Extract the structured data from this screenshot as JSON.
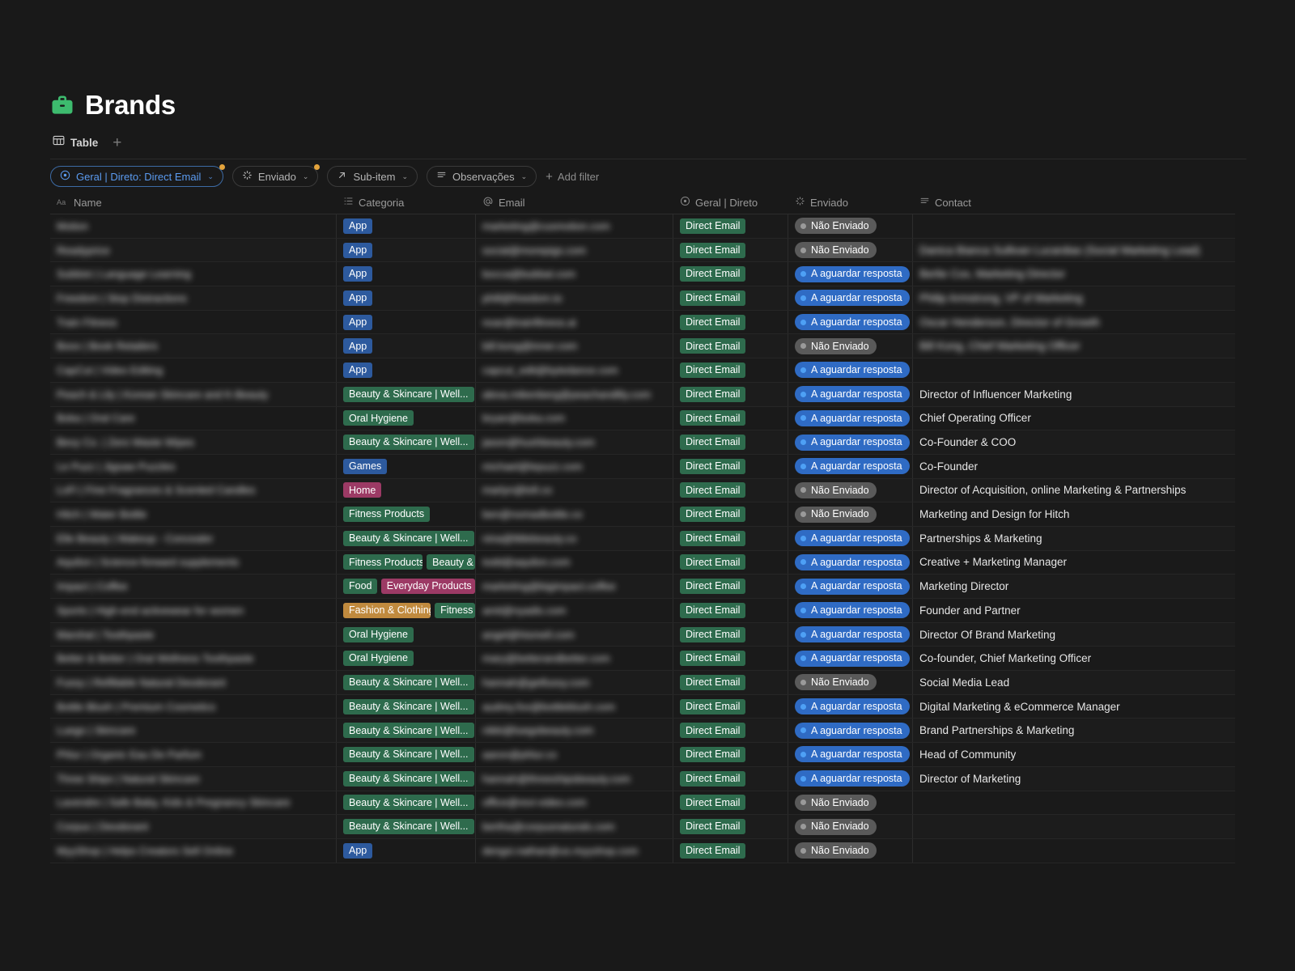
{
  "header": {
    "title": "Brands",
    "icon": "briefcase-icon",
    "icon_color": "#3dbb6e",
    "tabs": [
      {
        "label": "Table",
        "icon": "table-icon"
      }
    ],
    "add_tab_label": "+"
  },
  "filters": {
    "chips": [
      {
        "label": "Geral | Direto: Direct Email",
        "icon": "target-icon",
        "active": true,
        "has_badge": true,
        "caret": "⌄"
      },
      {
        "label": "Enviado",
        "icon": "loading-icon",
        "active": false,
        "has_badge": true,
        "caret": "⌄"
      },
      {
        "label": "Sub-item",
        "icon": "arrow-up-right-icon",
        "active": false,
        "has_badge": false,
        "caret": "⌄"
      },
      {
        "label": "Observações",
        "icon": "list-icon",
        "active": false,
        "has_badge": false,
        "caret": "⌄"
      }
    ],
    "add_filter_label": "Add filter"
  },
  "table": {
    "columns": [
      {
        "key": "name",
        "label": "Name",
        "icon": "text-aa-icon"
      },
      {
        "key": "categoria",
        "label": "Categoria",
        "icon": "multiselect-icon"
      },
      {
        "key": "email",
        "label": "Email",
        "icon": "at-icon"
      },
      {
        "key": "geral",
        "label": "Geral | Direto",
        "icon": "target-icon"
      },
      {
        "key": "enviado",
        "label": "Enviado",
        "icon": "loading-icon"
      },
      {
        "key": "contact",
        "label": "Contact",
        "icon": "list-icon"
      }
    ],
    "rows": [
      {
        "name": "Motion",
        "name_redacted": true,
        "categoria": [
          {
            "text": "App",
            "color": "blue"
          }
        ],
        "email": "marketing@cusmotion.com",
        "email_redacted": true,
        "geral": "Direct Email",
        "enviado": "Não Enviado",
        "enviado_state": "gray",
        "contact": "",
        "contact_redacted": false
      },
      {
        "name": "Readyprice",
        "name_redacted": true,
        "categoria": [
          {
            "text": "App",
            "color": "blue"
          }
        ],
        "email": "social@morepigs.com",
        "email_redacted": true,
        "geral": "Direct Email",
        "enviado": "Não Enviado",
        "enviado_state": "gray",
        "contact": "Danica Bianca Sullivan Lucardias (Social Marketing Lead)",
        "contact_redacted": true
      },
      {
        "name": "Subbist | Language Learning",
        "name_redacted": true,
        "categoria": [
          {
            "text": "App",
            "color": "blue"
          }
        ],
        "email": "bocca@bubbal.com",
        "email_redacted": true,
        "geral": "Direct Email",
        "enviado": "A aguardar resposta",
        "enviado_state": "blue",
        "contact": "Berlie Cox, Marketing Director",
        "contact_redacted": true
      },
      {
        "name": "Freedom | Stop Distractions",
        "name_redacted": true,
        "categoria": [
          {
            "text": "App",
            "color": "blue"
          }
        ],
        "email": "phill@freedom.to",
        "email_redacted": true,
        "geral": "Direct Email",
        "enviado": "A aguardar resposta",
        "enviado_state": "blue",
        "contact": "Philip Armstrong, VP of Marketing",
        "contact_redacted": true
      },
      {
        "name": "Train Fitness",
        "name_redacted": true,
        "categoria": [
          {
            "text": "App",
            "color": "blue"
          }
        ],
        "email": "noar@trainfitness.ai",
        "email_redacted": true,
        "geral": "Direct Email",
        "enviado": "A aguardar resposta",
        "enviado_state": "blue",
        "contact": "Oscar Henderson, Director of Growth",
        "contact_redacted": true
      },
      {
        "name": "Boox | Book Retailers",
        "name_redacted": true,
        "categoria": [
          {
            "text": "App",
            "color": "blue"
          }
        ],
        "email": "bill.kong@inner.com",
        "email_redacted": true,
        "geral": "Direct Email",
        "enviado": "Não Enviado",
        "enviado_state": "gray",
        "contact": "Bill Kong, Chief Marketing Officer",
        "contact_redacted": true
      },
      {
        "name": "CapCut | Video Editing",
        "name_redacted": true,
        "categoria": [
          {
            "text": "App",
            "color": "blue"
          }
        ],
        "email": "capcut_edit@bytedance.com",
        "email_redacted": true,
        "geral": "Direct Email",
        "enviado": "A aguardar resposta",
        "enviado_state": "blue",
        "contact": "",
        "contact_redacted": false
      },
      {
        "name": "Peach & Lily | Korean Skincare and K-Beauty",
        "name_redacted": true,
        "categoria": [
          {
            "text": "Beauty & Skincare | Well...",
            "color": "green"
          }
        ],
        "email": "alexa.mikenberg@peachandlily.com",
        "email_redacted": true,
        "geral": "Direct Email",
        "enviado": "A aguardar resposta",
        "enviado_state": "blue",
        "contact": "Director of Influencer Marketing",
        "contact_redacted": false
      },
      {
        "name": "Boka | Oral Care",
        "name_redacted": true,
        "categoria": [
          {
            "text": "Oral Hygiene",
            "color": "green"
          }
        ],
        "email": "bryan@boka.com",
        "email_redacted": true,
        "geral": "Direct Email",
        "enviado": "A aguardar resposta",
        "enviado_state": "blue",
        "contact": "Chief Operating Officer",
        "contact_redacted": false
      },
      {
        "name": "Bevy Co. | Zero Waste Wipes",
        "name_redacted": true,
        "categoria": [
          {
            "text": "Beauty & Skincare | Well...",
            "color": "green"
          }
        ],
        "email": "jason@hushbeauty.com",
        "email_redacted": true,
        "geral": "Direct Email",
        "enviado": "A aguardar resposta",
        "enviado_state": "blue",
        "contact": "Co-Founder & COO",
        "contact_redacted": false
      },
      {
        "name": "Le Puzz | Jigsaw Puzzles",
        "name_redacted": true,
        "categoria": [
          {
            "text": "Games",
            "color": "blue"
          }
        ],
        "email": "michael@lepuzz.com",
        "email_redacted": true,
        "geral": "Direct Email",
        "enviado": "A aguardar resposta",
        "enviado_state": "blue",
        "contact": "Co-Founder",
        "contact_redacted": false
      },
      {
        "name": "LoFi | Fine Fragrances & Scented Candles",
        "name_redacted": true,
        "categoria": [
          {
            "text": "Home",
            "color": "pink"
          }
        ],
        "email": "marlyn@lofi.co",
        "email_redacted": true,
        "geral": "Direct Email",
        "enviado": "Não Enviado",
        "enviado_state": "gray",
        "contact": "Director of Acquisition, online Marketing & Partnerships",
        "contact_redacted": false
      },
      {
        "name": "Hitch | Water Bottle",
        "name_redacted": true,
        "categoria": [
          {
            "text": "Fitness Products",
            "color": "green"
          }
        ],
        "email": "ben@nomadbottle.co",
        "email_redacted": true,
        "geral": "Direct Email",
        "enviado": "Não Enviado",
        "enviado_state": "gray",
        "contact": "Marketing and Design for Hitch",
        "contact_redacted": false
      },
      {
        "name": "Elle Beauty | Makeup - Concealer",
        "name_redacted": true,
        "categoria": [
          {
            "text": "Beauty & Skincare | Well...",
            "color": "green"
          }
        ],
        "email": "nina@littlebeauty.co",
        "email_redacted": true,
        "geral": "Direct Email",
        "enviado": "A aguardar resposta",
        "enviado_state": "blue",
        "contact": "Partnerships & Marketing",
        "contact_redacted": false
      },
      {
        "name": "Aquilon | Science-forward supplements",
        "name_redacted": true,
        "categoria": [
          {
            "text": "Fitness Products",
            "color": "green"
          },
          {
            "text": "Beauty &",
            "color": "green"
          }
        ],
        "email": "todd@aquilon.com",
        "email_redacted": true,
        "geral": "Direct Email",
        "enviado": "A aguardar resposta",
        "enviado_state": "blue",
        "contact": "Creative + Marketing Manager",
        "contact_redacted": false
      },
      {
        "name": "Impact | Coffee",
        "name_redacted": true,
        "categoria": [
          {
            "text": "Food",
            "color": "green"
          },
          {
            "text": "Everyday Products",
            "color": "pink"
          }
        ],
        "email": "marketing@bigimpact.coffee",
        "email_redacted": true,
        "geral": "Direct Email",
        "enviado": "A aguardar resposta",
        "enviado_state": "blue",
        "contact": "Marketing Director",
        "contact_redacted": false
      },
      {
        "name": "Sports | High-end activewear for women",
        "name_redacted": true,
        "categoria": [
          {
            "text": "Fashion & Clothing",
            "color": "orange"
          },
          {
            "text": "Fitness",
            "color": "green"
          }
        ],
        "email": "amit@nyadis.com",
        "email_redacted": true,
        "geral": "Direct Email",
        "enviado": "A aguardar resposta",
        "enviado_state": "blue",
        "contact": "Founder and Partner",
        "contact_redacted": false
      },
      {
        "name": "Marshal | Toothpaste",
        "name_redacted": true,
        "categoria": [
          {
            "text": "Oral Hygiene",
            "color": "green"
          }
        ],
        "email": "angel@hismell.com",
        "email_redacted": true,
        "geral": "Direct Email",
        "enviado": "A aguardar resposta",
        "enviado_state": "blue",
        "contact": "Director Of Brand Marketing",
        "contact_redacted": false
      },
      {
        "name": "Better & Better | Oral Wellness Toothpaste",
        "name_redacted": true,
        "categoria": [
          {
            "text": "Oral Hygiene",
            "color": "green"
          }
        ],
        "email": "mary@betterandbetter.com",
        "email_redacted": true,
        "geral": "Direct Email",
        "enviado": "A aguardar resposta",
        "enviado_state": "blue",
        "contact": "Co-founder, Chief Marketing Officer",
        "contact_redacted": false
      },
      {
        "name": "Fussy | Refillable Natural Deodorant",
        "name_redacted": true,
        "categoria": [
          {
            "text": "Beauty & Skincare | Well...",
            "color": "green"
          }
        ],
        "email": "hannah@getfussy.com",
        "email_redacted": true,
        "geral": "Direct Email",
        "enviado": "Não Enviado",
        "enviado_state": "gray",
        "contact": "Social Media Lead",
        "contact_redacted": false
      },
      {
        "name": "Bottle Blush | Premium Cosmetics",
        "name_redacted": true,
        "categoria": [
          {
            "text": "Beauty & Skincare | Well...",
            "color": "green"
          }
        ],
        "email": "audrey.fox@bottleblush.com",
        "email_redacted": true,
        "geral": "Direct Email",
        "enviado": "A aguardar resposta",
        "enviado_state": "blue",
        "contact": "Digital Marketing & eCommerce Manager",
        "contact_redacted": false
      },
      {
        "name": "Luego | Skincare",
        "name_redacted": true,
        "categoria": [
          {
            "text": "Beauty & Skincare | Well...",
            "color": "green"
          }
        ],
        "email": "nikki@luegobeauty.com",
        "email_redacted": true,
        "geral": "Direct Email",
        "enviado": "A aguardar resposta",
        "enviado_state": "blue",
        "contact": "Brand Partnerships & Marketing",
        "contact_redacted": false
      },
      {
        "name": "Phlur | Organic Eau De Parfum",
        "name_redacted": true,
        "categoria": [
          {
            "text": "Beauty & Skincare | Well...",
            "color": "green"
          }
        ],
        "email": "aaron@phlur.co",
        "email_redacted": true,
        "geral": "Direct Email",
        "enviado": "A aguardar resposta",
        "enviado_state": "blue",
        "contact": "Head of Community",
        "contact_redacted": false
      },
      {
        "name": "Three Ships | Natural Skincare",
        "name_redacted": true,
        "categoria": [
          {
            "text": "Beauty & Skincare | Well...",
            "color": "green"
          }
        ],
        "email": "hannah@threeshipsbeauty.com",
        "email_redacted": true,
        "geral": "Direct Email",
        "enviado": "A aguardar resposta",
        "enviado_state": "blue",
        "contact": "Director of Marketing",
        "contact_redacted": false
      },
      {
        "name": "Lavendre | Safe Baby, Kids & Pregnancy Skincare",
        "name_redacted": true,
        "categoria": [
          {
            "text": "Beauty & Skincare | Well...",
            "color": "green"
          }
        ],
        "email": "office@revi-video.com",
        "email_redacted": true,
        "geral": "Direct Email",
        "enviado": "Não Enviado",
        "enviado_state": "gray",
        "contact": "",
        "contact_redacted": false
      },
      {
        "name": "Corpus | Deodorant",
        "name_redacted": true,
        "categoria": [
          {
            "text": "Beauty & Skincare | Well...",
            "color": "green"
          }
        ],
        "email": "bertha@corpusnaturals.com",
        "email_redacted": true,
        "geral": "Direct Email",
        "enviado": "Não Enviado",
        "enviado_state": "gray",
        "contact": "",
        "contact_redacted": false
      },
      {
        "name": "MyyShop | Helps Creators Sell Online",
        "name_redacted": true,
        "categoria": [
          {
            "text": "App",
            "color": "blue"
          }
        ],
        "email": "dengxi.nathan@us.myyshop.com",
        "email_redacted": true,
        "geral": "Direct Email",
        "enviado": "Não Enviado",
        "enviado_state": "gray",
        "contact": "",
        "contact_redacted": false
      }
    ]
  },
  "colors": {
    "background": "#191919",
    "tag_blue": "#2d5a9e",
    "tag_green": "#2e6b4d",
    "tag_pink": "#9c3a65",
    "tag_orange": "#c08a3e",
    "pill_gray": "#5a5a5a",
    "pill_blue": "#2f6bc4",
    "accent_blue": "#5b9bf0",
    "badge_orange": "#e3a33c"
  }
}
